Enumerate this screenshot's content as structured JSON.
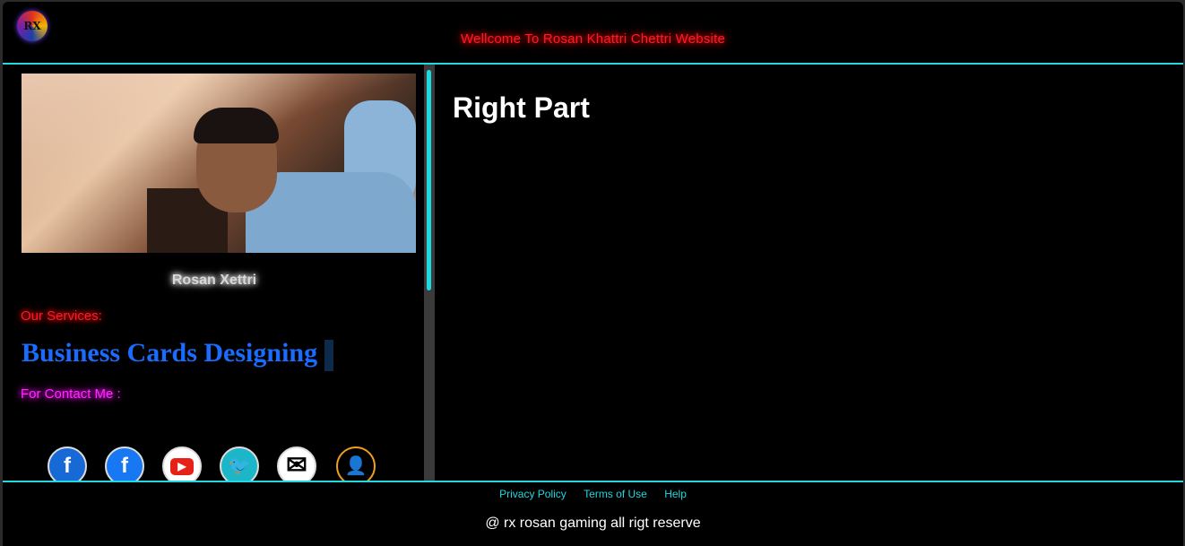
{
  "header": {
    "logo_text": "RX",
    "welcome": "Wellcome To Rosan Khattri Chettri Website"
  },
  "profile": {
    "name": "Rosan Xettri"
  },
  "services": {
    "label": "Our Services:",
    "current": "Business Cards Designing"
  },
  "contact": {
    "label": "For Contact Me :"
  },
  "social": {
    "icons": [
      "facebook-icon",
      "facebook-icon",
      "youtube-icon",
      "twitter-icon",
      "mail-icon",
      "user-contact-icon"
    ]
  },
  "main": {
    "title": "Right Part"
  },
  "footer": {
    "links": [
      "Privacy Policy",
      "Terms of Use",
      "Help"
    ],
    "copyright": "@ rx rosan gaming all rigt reserve"
  },
  "colors": {
    "accent": "#1fd8e0",
    "welcome": "#ff1a2a",
    "services_text": "#1a6cff",
    "contact": "#ff2bff"
  }
}
